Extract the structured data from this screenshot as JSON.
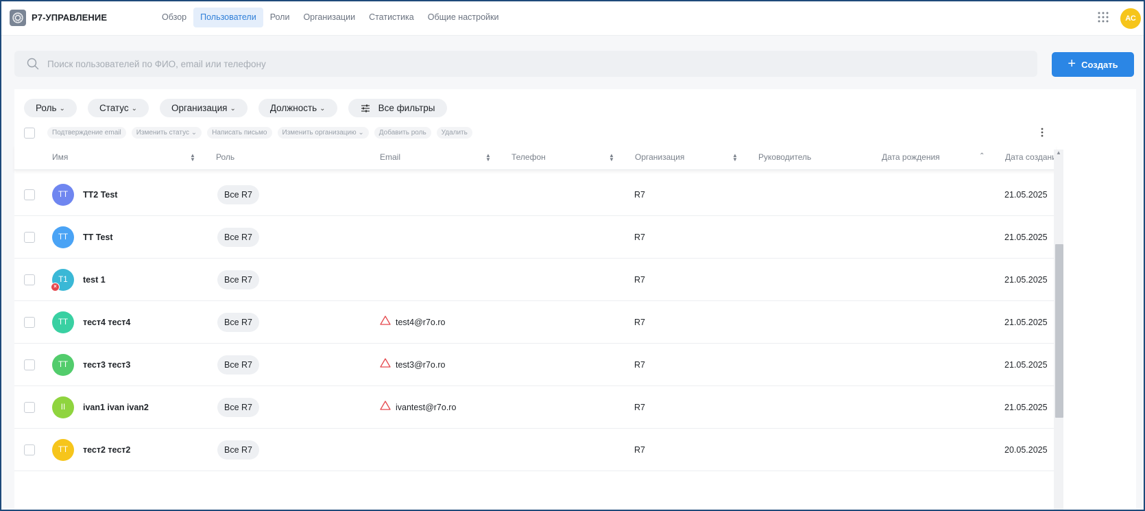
{
  "header": {
    "brand": "Р7-УПРАВЛЕНИЕ",
    "tabs": [
      {
        "label": "Обзор",
        "active": false
      },
      {
        "label": "Пользователи",
        "active": true
      },
      {
        "label": "Роли",
        "active": false
      },
      {
        "label": "Организации",
        "active": false
      },
      {
        "label": "Статистика",
        "active": false
      },
      {
        "label": "Общие настройки",
        "active": false
      }
    ],
    "user_initials": "АС",
    "accent_color": "#2b86e5",
    "avatar_color": "#f6c51b"
  },
  "search": {
    "placeholder": "Поиск пользователей по ФИО, email или телефону",
    "value": ""
  },
  "create_button": {
    "label": "Создать",
    "icon": "plus-icon"
  },
  "filters": [
    {
      "label": "Роль"
    },
    {
      "label": "Статус"
    },
    {
      "label": "Организация"
    },
    {
      "label": "Должность"
    }
  ],
  "all_filters": {
    "label": "Все фильтры",
    "icon": "sliders-icon"
  },
  "bulk_actions": [
    {
      "label": "Подтверждение email",
      "dropdown": false
    },
    {
      "label": "Изменить статус",
      "dropdown": true
    },
    {
      "label": "Написать письмо",
      "dropdown": false
    },
    {
      "label": "Изменить организацию",
      "dropdown": true
    },
    {
      "label": "Добавить роль",
      "dropdown": false
    },
    {
      "label": "Удалить",
      "dropdown": false
    }
  ],
  "columns": {
    "name": "Имя",
    "role": "Роль",
    "email": "Email",
    "phone": "Телефон",
    "organization": "Организация",
    "manager": "Руководитель",
    "birth_date": "Дата рождения",
    "created": "Дата создания"
  },
  "users": [
    {
      "initials": "TT",
      "avatar_color": "#6f86f0",
      "name": "TT2 Test",
      "role": "Все R7",
      "email": "",
      "email_warning": false,
      "organization": "R7",
      "created": "21.05.2025",
      "error": false
    },
    {
      "initials": "TT",
      "avatar_color": "#4aa3f5",
      "name": "TT Test",
      "role": "Все R7",
      "email": "",
      "email_warning": false,
      "organization": "R7",
      "created": "21.05.2025",
      "error": false
    },
    {
      "initials": "T1",
      "avatar_color": "#3ab8d6",
      "name": "test 1",
      "role": "Все R7",
      "email": "",
      "email_warning": false,
      "organization": "R7",
      "created": "21.05.2025",
      "error": true
    },
    {
      "initials": "TT",
      "avatar_color": "#39d0a2",
      "name": "тест4 тест4",
      "role": "Все R7",
      "email": "test4@r7o.ro",
      "email_warning": true,
      "organization": "R7",
      "created": "21.05.2025",
      "error": false
    },
    {
      "initials": "TT",
      "avatar_color": "#52cc6c",
      "name": "тест3 тест3",
      "role": "Все R7",
      "email": "test3@r7o.ro",
      "email_warning": true,
      "organization": "R7",
      "created": "21.05.2025",
      "error": false
    },
    {
      "initials": "II",
      "avatar_color": "#8fd43e",
      "name": "ivan1 ivan ivan2",
      "role": "Все R7",
      "email": "ivantest@r7o.ro",
      "email_warning": true,
      "organization": "R7",
      "created": "21.05.2025",
      "error": false
    },
    {
      "initials": "TT",
      "avatar_color": "#f6c51b",
      "name": "тест2 тест2",
      "role": "Все R7",
      "email": "",
      "email_warning": false,
      "organization": "R7",
      "created": "20.05.2025",
      "error": false
    }
  ],
  "colors": {
    "warning": "#e5484d",
    "error_badge": "#e5484d"
  }
}
